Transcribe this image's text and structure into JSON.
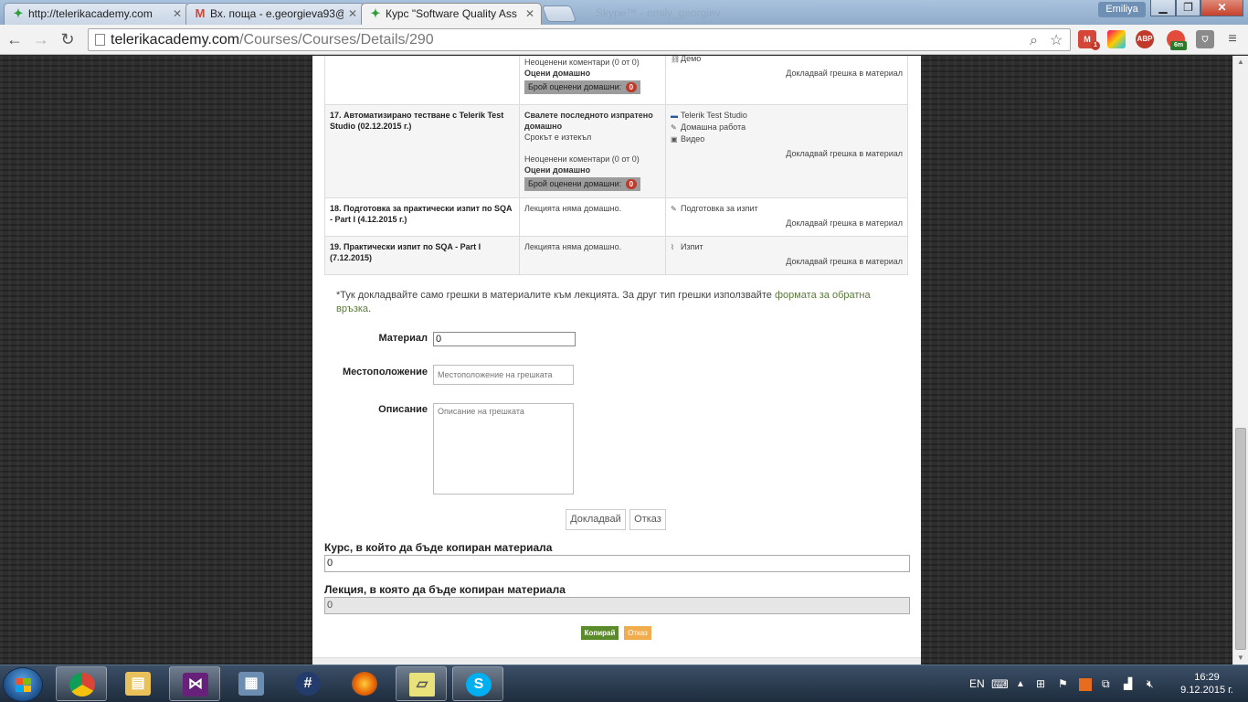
{
  "browser": {
    "tabs": [
      {
        "title": "http://telerikacademy.com",
        "icon": "telerik-icon"
      },
      {
        "title": "Вх. поща - e.georgieva93@",
        "icon": "gmail-icon"
      },
      {
        "title": "Курс \"Software Quality Ass",
        "icon": "telerik-icon"
      }
    ],
    "ghost_tab": "Skype™ - emily_georgiev",
    "user": "Emiliya",
    "url_host": "telerikacademy.com",
    "url_path": "/Courses/Courses/Details/290",
    "extensions": {
      "gmail_badge": "1",
      "abp": "ABP",
      "timer_badge": "6m"
    }
  },
  "lectures": [
    {
      "title": "",
      "homework": {
        "lines": [],
        "comments": "Неоценени коментари (0 от 0)",
        "rate": "Оцени домашно",
        "graded_label": "Брой оценени домашни:",
        "graded_count": "0"
      },
      "resources": [
        {
          "icon": "link-icon",
          "label": "Демо"
        }
      ],
      "report": "Докладвай грешка в материал"
    },
    {
      "title": "17. Автоматизирано тестване с Telerik Test Studio (02.12.2015 г.)",
      "homework": {
        "lines": [
          "Свалете последното изпратено домашно",
          "Срокът е изтекъл"
        ],
        "comments": "Неоценени коментари (0 от 0)",
        "rate": "Оцени домашно",
        "graded_label": "Брой оценени домашни:",
        "graded_count": "0"
      },
      "resources": [
        {
          "icon": "presentation-icon",
          "label": "Telerik Test Studio"
        },
        {
          "icon": "pencil-icon",
          "label": "Домашна работа"
        },
        {
          "icon": "video-icon",
          "label": "Видео"
        }
      ],
      "report": "Докладвай грешка в материал"
    },
    {
      "title": "18. Подготовка за практически изпит по SQA - Part I (4.12.2015 г.)",
      "homework_text": "Лекцията няма домашно.",
      "resources": [
        {
          "icon": "pencil-icon",
          "label": "Подготовка за изпит"
        }
      ],
      "report": "Докладвай грешка в материал"
    },
    {
      "title": "19. Практически изпит по SQA - Part I (7.12.2015)",
      "homework_text": "Лекцията няма домашно.",
      "resources": [
        {
          "icon": "clip-icon",
          "label": "Изпит"
        }
      ],
      "report": "Докладвай грешка в материал"
    }
  ],
  "report_form": {
    "note_prefix": "*Тук докладвайте само грешки в материалите към лекцията. За друг тип грешки използвайте ",
    "note_link": "формата за обратна връзка",
    "note_suffix": ".",
    "material_label": "Материал",
    "material_value": "0",
    "location_label": "Местоположение",
    "location_placeholder": "Местоположение на грешката",
    "description_label": "Описание",
    "description_placeholder": "Описание на грешката",
    "submit": "Докладвай",
    "cancel": "Отказ"
  },
  "copy_material": {
    "course_label": "Курс, в който да бъде копиран материала",
    "course_value": "0",
    "lecture_label": "Лекция, в която да бъде копиран материала",
    "lecture_value": "0",
    "copy_button": "Копирай",
    "cancel_button": "Отказ"
  },
  "taskbar": {
    "apps": [
      "chrome-icon",
      "explorer-icon",
      "visual-studio-icon",
      "calculator-icon",
      "team-icon",
      "firefox-icon",
      "notes-icon",
      "skype-icon"
    ],
    "language": "EN",
    "time": "16:29",
    "date": "9.12.2015 г."
  },
  "colors": {
    "accent_green": "#5a8a2a",
    "accent_orange": "#f0ad4e",
    "badge_red": "#c0392b"
  }
}
